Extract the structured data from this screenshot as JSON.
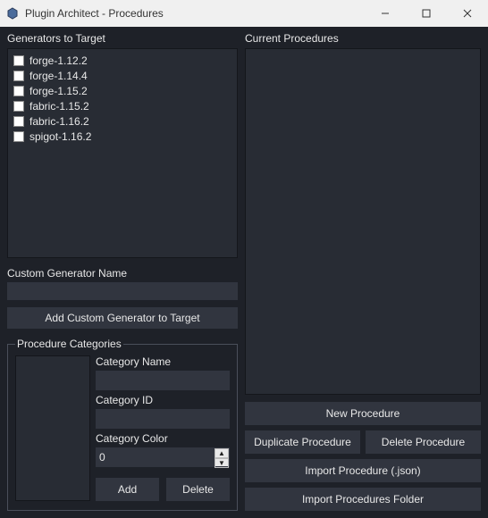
{
  "window": {
    "title": "Plugin Architect - Procedures"
  },
  "left": {
    "generators_label": "Generators to Target",
    "generators": [
      {
        "label": "forge-1.12.2"
      },
      {
        "label": "forge-1.14.4"
      },
      {
        "label": "forge-1.15.2"
      },
      {
        "label": "fabric-1.15.2"
      },
      {
        "label": "fabric-1.16.2"
      },
      {
        "label": "spigot-1.16.2"
      }
    ],
    "custom_gen_label": "Custom Generator Name",
    "custom_gen_value": "",
    "add_custom_btn": "Add Custom Generator to Target",
    "group_legend": "Procedure Categories",
    "cat_name_label": "Category Name",
    "cat_name_value": "",
    "cat_id_label": "Category ID",
    "cat_id_value": "",
    "cat_color_label": "Category Color",
    "cat_color_value": "0",
    "add_btn": "Add",
    "delete_btn": "Delete"
  },
  "right": {
    "current_label": "Current Procedures",
    "new_btn": "New Procedure",
    "dup_btn": "Duplicate Procedure",
    "del_btn": "Delete Procedure",
    "import_json_btn": "Import Procedure (.json)",
    "import_folder_btn": "Import Procedures Folder"
  }
}
